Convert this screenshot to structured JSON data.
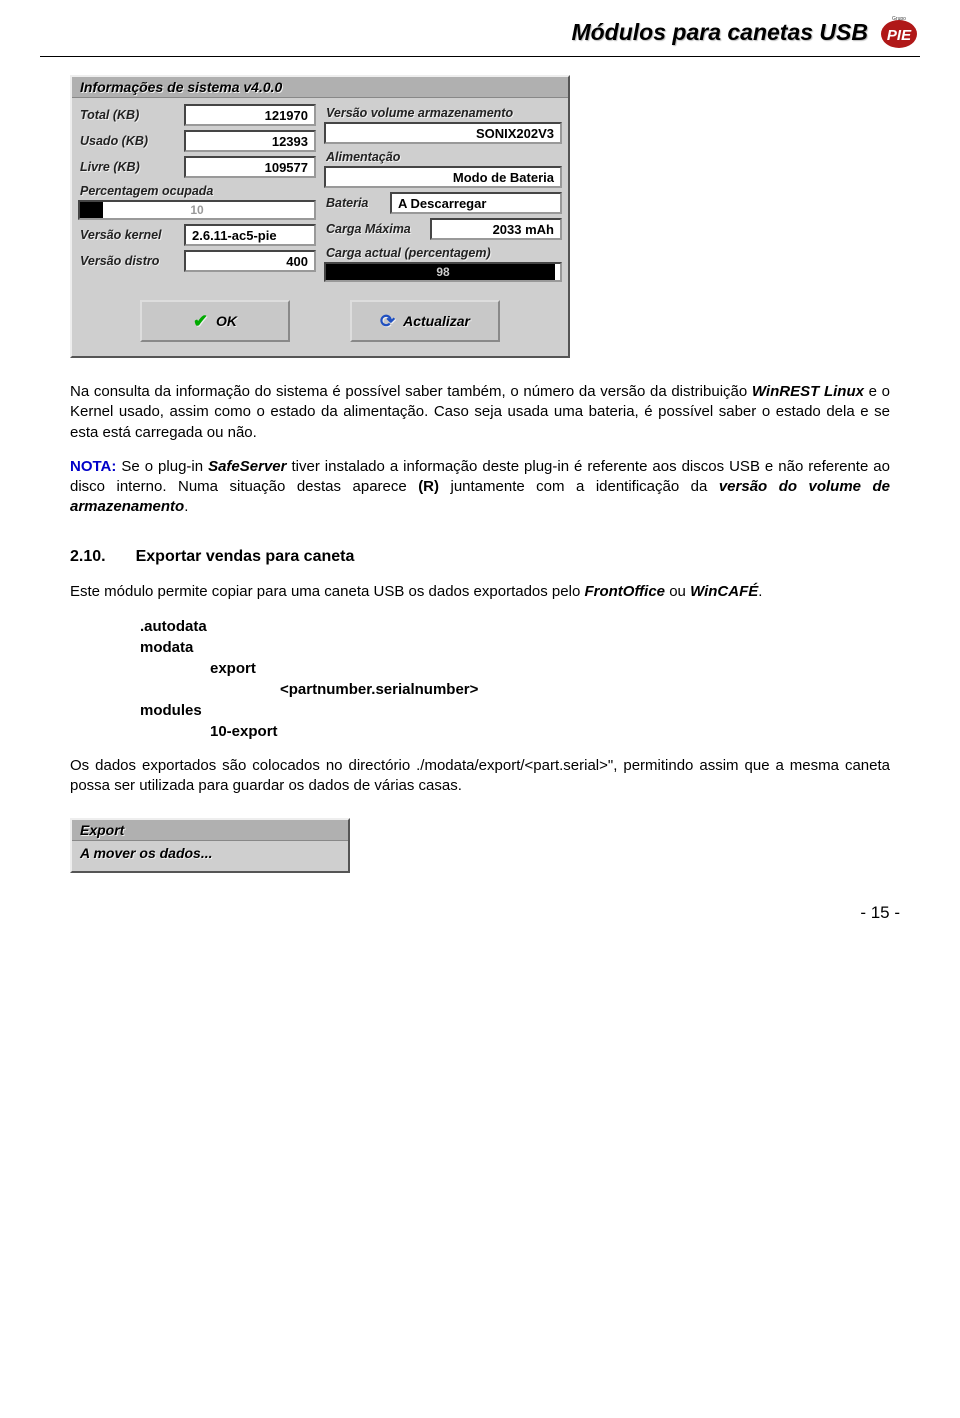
{
  "header": {
    "title": "Módulos para canetas USB",
    "logo_label": "Grupo PIE"
  },
  "dialog": {
    "title": "Informações de sistema v4.0.0",
    "left": {
      "total_label": "Total (KB)",
      "total_value": "121970",
      "usado_label": "Usado (KB)",
      "usado_value": "12393",
      "livre_label": "Livre (KB)",
      "livre_value": "109577",
      "percent_label": "Percentagem ocupada",
      "percent_value": "10",
      "percent_num": 10,
      "kernel_label": "Versão kernel",
      "kernel_value": "2.6.11-ac5-pie",
      "distro_label": "Versão distro",
      "distro_value": "400"
    },
    "right": {
      "volume_label": "Versão volume armazenamento",
      "volume_value": "SONIX202V3",
      "aliment_label": "Alimentação",
      "aliment_value": "Modo de Bateria",
      "bateria_label": "Bateria",
      "bateria_value": "A Descarregar",
      "carga_max_label": "Carga Máxima",
      "carga_max_value": "2033 mAh",
      "carga_act_label": "Carga actual (percentagem)",
      "carga_act_value": "98",
      "carga_act_num": 98
    },
    "buttons": {
      "ok": "OK",
      "refresh": "Actualizar"
    }
  },
  "para1": {
    "t1": "Na consulta da informação do sistema é possível saber também, o número da versão da distribuição ",
    "brand1": "WinREST Linux",
    "t2": " e o Kernel usado, assim como o estado da alimentação. Caso seja usada uma bateria, é possível saber o estado dela e se esta está carregada ou não."
  },
  "note": {
    "label": "NOTA:",
    "t1": " Se o plug-in ",
    "brand": "SafeServer",
    "t2": " tiver instalado a informação deste plug-in é referente aos discos USB e não referente ao disco interno. Numa situação destas aparece ",
    "r": "(R)",
    "t3": " juntamente com a identificação da ",
    "ital": "versão do volume de armazenamento",
    "period": "."
  },
  "section": {
    "num": "2.10.",
    "title": "Exportar vendas para caneta"
  },
  "para2": {
    "t1": "Este módulo permite copiar para uma caneta USB os dados exportados pelo ",
    "brand1": "FrontOffice",
    "t2": " ou ",
    "brand2": "WinCAFÉ",
    "t3": "."
  },
  "code": {
    "l1": ".autodata",
    "l2": "modata",
    "l3": "export",
    "l4": "<partnumber.serialnumber>",
    "l5": "modules",
    "l6": "10-export"
  },
  "para3": "Os dados exportados são colocados no directório ./modata/export/<part.serial>\", permitindo assim que a mesma caneta possa ser utilizada para guardar os dados de várias casas.",
  "dialog2": {
    "title": "Export",
    "body": "A mover os dados..."
  },
  "page_number": "- 15 -"
}
